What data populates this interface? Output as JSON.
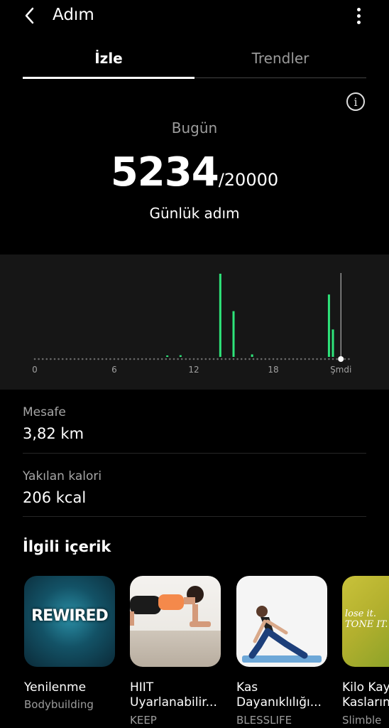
{
  "header": {
    "title": "Adım",
    "back_icon": "chevron-left-icon",
    "more_icon": "more-vertical-icon"
  },
  "tabs": [
    {
      "label": "İzle",
      "active": true
    },
    {
      "label": "Trendler",
      "active": false
    }
  ],
  "info_icon": "info-icon",
  "summary": {
    "period": "Bugün",
    "steps": "5234",
    "goal": "/20000",
    "caption": "Günlük adım"
  },
  "chart_data": {
    "type": "bar",
    "x_tick_labels": [
      "0",
      "6",
      "12",
      "18",
      "Şmdi"
    ],
    "bars": [
      {
        "hour": 10.0,
        "value": 1
      },
      {
        "hour": 11.0,
        "value": 2
      },
      {
        "hour": 14.0,
        "value": 100
      },
      {
        "hour": 15.0,
        "value": 55
      },
      {
        "hour": 16.4,
        "value": 3
      },
      {
        "hour": 22.2,
        "value": 75
      },
      {
        "hour": 22.5,
        "value": 33
      }
    ],
    "x_range": [
      0,
      24
    ],
    "now_hour": 23.1,
    "bar_color": "#2ee57a",
    "grid": false
  },
  "stats": [
    {
      "label": "Mesafe",
      "value": "3,82 km"
    },
    {
      "label": "Yakılan kalori",
      "value": "206 kcal"
    }
  ],
  "related": {
    "title": "İlgili içerik",
    "items": [
      {
        "title": "Yenilenme",
        "title2": "",
        "subtitle": "Bodybuilding",
        "thumb_text": "REWIRED"
      },
      {
        "title": "HIIT",
        "title2": "Uyarlanabilir...",
        "subtitle": "KEEP",
        "thumb_text": ""
      },
      {
        "title": "Kas",
        "title2": "Dayanıklılığı...",
        "subtitle": "BLESSLIFE",
        "thumb_text": ""
      },
      {
        "title": "Kilo Kay",
        "title2": "Kasların",
        "subtitle": "Slimble",
        "thumb_text": "lose it. TONE IT."
      }
    ]
  }
}
